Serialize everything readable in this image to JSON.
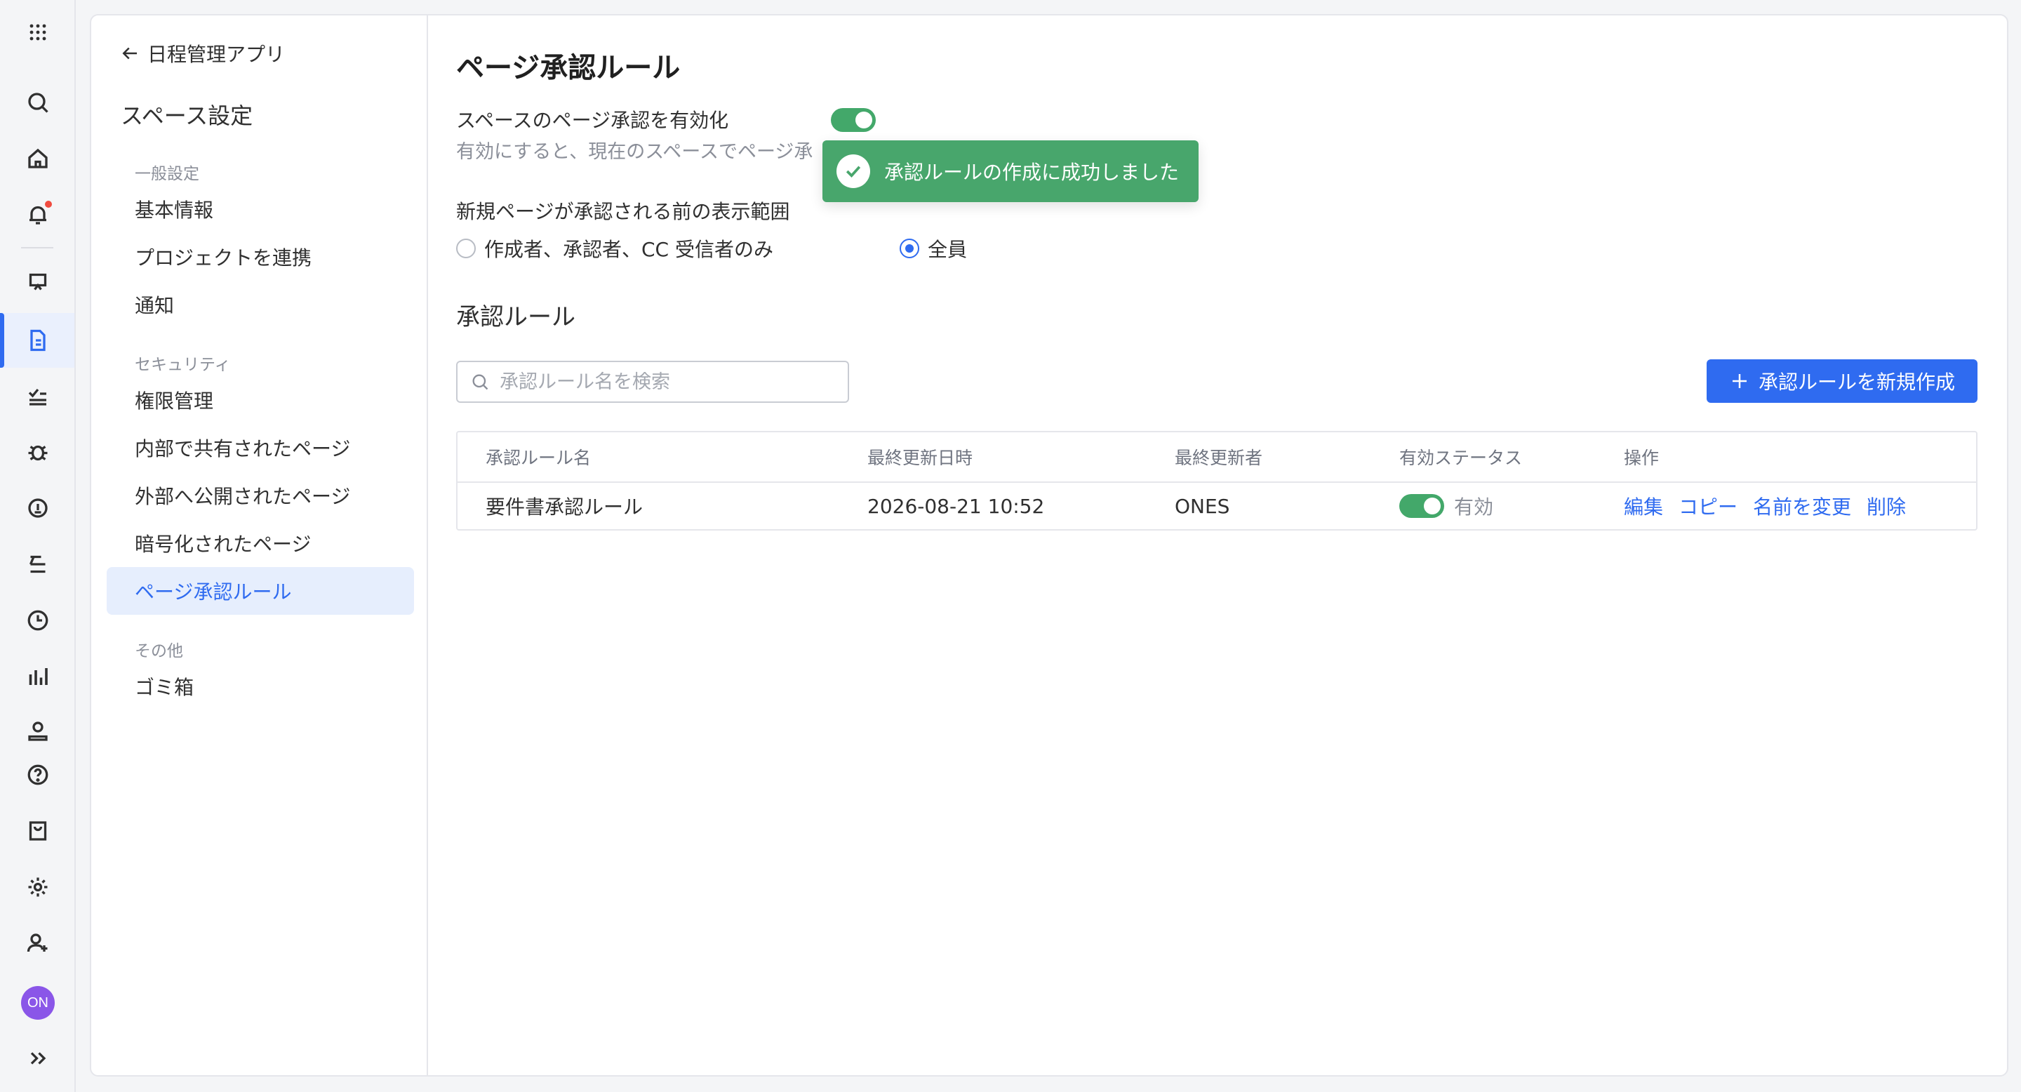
{
  "colors": {
    "accent": "#2f6bf0",
    "success": "#48a66c",
    "toggle_on": "#43a86a",
    "notification_dot": "#f04b3f",
    "avatar": "#8a56e8"
  },
  "rail": {
    "icons": [
      "apps-grid-icon",
      "search-icon",
      "home-icon",
      "bell-icon",
      "monitor-icon",
      "document-icon",
      "task-check-icon",
      "bug-icon",
      "rocket-icon",
      "list-icon",
      "clock-icon",
      "chart-icon",
      "user-stamp-icon",
      "help-icon",
      "shopping-bag-icon",
      "settings-icon",
      "add-user-icon"
    ],
    "avatar_text": "ON",
    "expand_icon": "double-chevron-right-icon"
  },
  "sidebar": {
    "back_label": "日程管理アプリ",
    "title": "スペース設定",
    "groups": [
      {
        "label": "一般設定",
        "items": [
          "基本情報",
          "プロジェクトを連携",
          "通知"
        ]
      },
      {
        "label": "セキュリティ",
        "items": [
          "権限管理",
          "内部で共有されたページ",
          "外部へ公開されたページ",
          "暗号化されたページ",
          "ページ承認ルール"
        ]
      },
      {
        "label": "その他",
        "items": [
          "ゴミ箱"
        ]
      }
    ],
    "active_item": "ページ承認ルール"
  },
  "main": {
    "title": "ページ承認ルール",
    "enable_label": "スペースのページ承認を有効化",
    "enable_on": true,
    "enable_hint": "有効にすると、現在のスペースでページ承",
    "visibility_label": "新規ページが承認される前の表示範囲",
    "visibility_options": [
      "作成者、承認者、CC 受信者のみ",
      "全員"
    ],
    "visibility_selected": "全員",
    "rules_title": "承認ルール",
    "search_placeholder": "承認ルール名を検索",
    "new_button": "承認ルールを新規作成",
    "table": {
      "headers": [
        "承認ルール名",
        "最終更新日時",
        "最終更新者",
        "有効ステータス",
        "操作"
      ],
      "rows": [
        {
          "name": "要件書承認ルール",
          "updated": "2026-08-21 10:52",
          "updater": "ONES",
          "status": "有効",
          "enabled": true,
          "actions": [
            "編集",
            "コピー",
            "名前を変更",
            "削除"
          ]
        }
      ]
    }
  },
  "toast": {
    "message": "承認ルールの作成に成功しました"
  }
}
